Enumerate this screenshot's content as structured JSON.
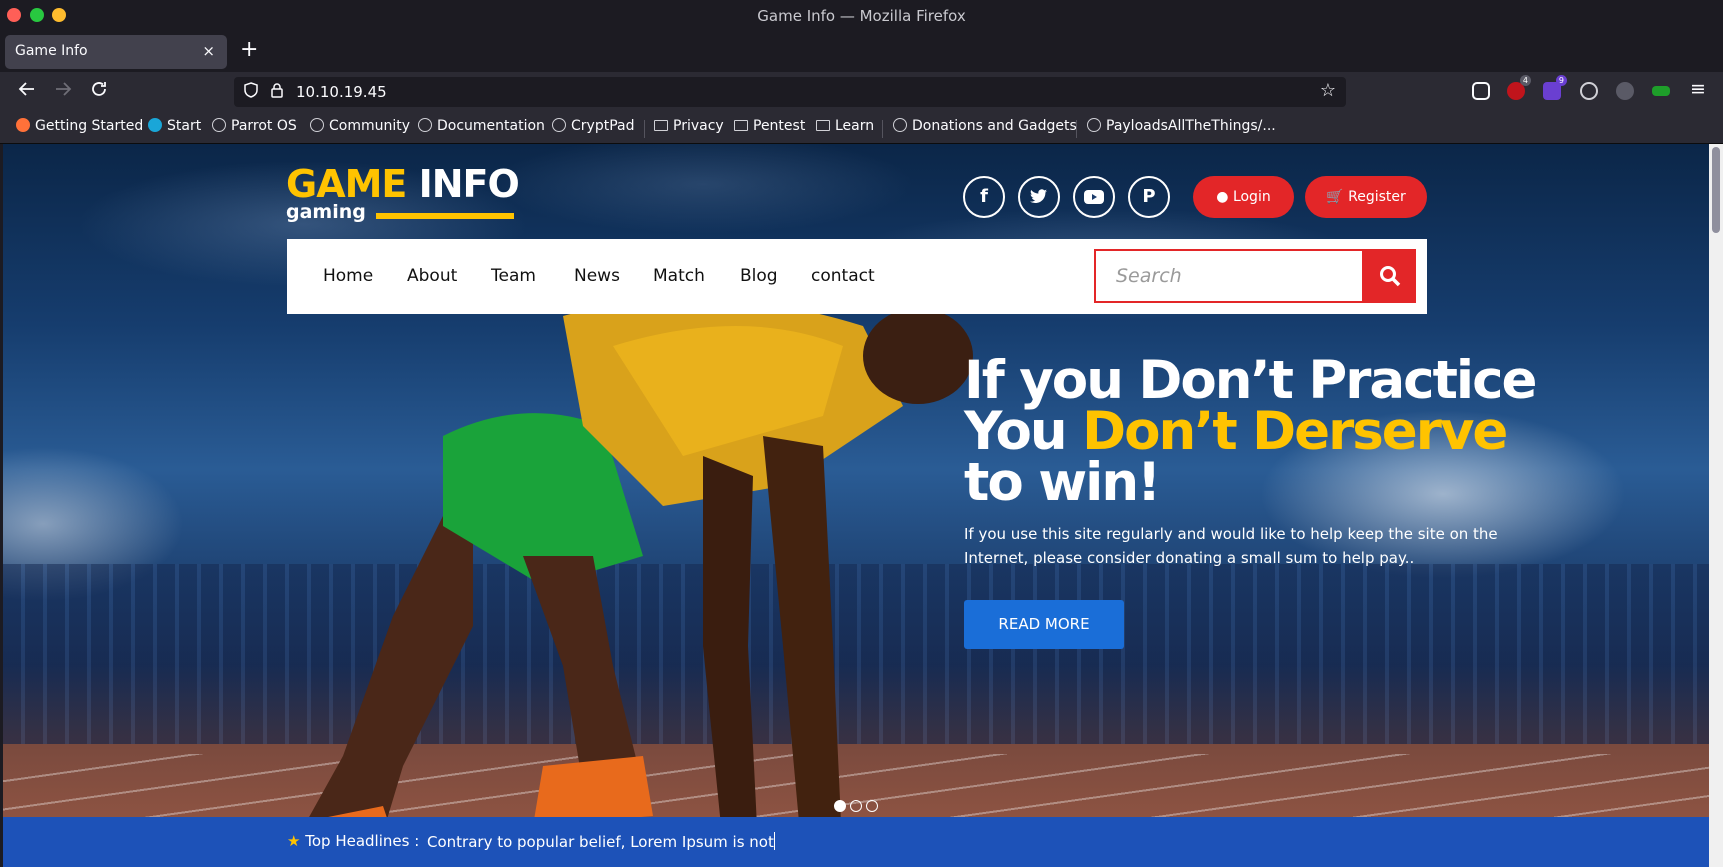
{
  "window": {
    "title": "Game Info — Mozilla Firefox"
  },
  "tab": {
    "title": "Game Info",
    "close": "×",
    "new_tab": "+"
  },
  "url": {
    "value": "10.10.19.45"
  },
  "bookmarks": [
    {
      "label": "Getting Started",
      "type": "firefox"
    },
    {
      "label": "Start",
      "type": "parrot"
    },
    {
      "label": "Parrot OS",
      "type": "globe"
    },
    {
      "label": "Community",
      "type": "globe"
    },
    {
      "label": "Documentation",
      "type": "globe"
    },
    {
      "label": "CryptPad",
      "type": "globe"
    },
    {
      "label": "Privacy",
      "type": "folder"
    },
    {
      "label": "Pentest",
      "type": "folder"
    },
    {
      "label": "Learn",
      "type": "folder"
    },
    {
      "label": "Donations and Gadgets",
      "type": "globe"
    },
    {
      "label": "PayloadsAllTheThings/...",
      "type": "globe"
    }
  ],
  "extensions": {
    "badge_1": "4",
    "badge_2": "9"
  },
  "site": {
    "logo": {
      "game": "GAME",
      "info": "INFO",
      "sub": "gaming"
    },
    "social": [
      "facebook",
      "twitter",
      "youtube",
      "pinterest"
    ],
    "login": "Login",
    "register": "Register",
    "menu": [
      "Home",
      "About",
      "Team",
      "News",
      "Match",
      "Blog",
      "contact"
    ],
    "search_placeholder": "Search",
    "hero": {
      "line1": "If you Don’t Practice",
      "line2_a": "You ",
      "line2_b": "Don’t Derserve",
      "line3": "to win!",
      "paragraph": "If you use this site regularly and would like to help keep the site on the Internet, please consider donating a small sum to help pay..",
      "cta": "READ MORE"
    },
    "slider": {
      "count": 3,
      "active": 0
    },
    "ticker": {
      "label": "Top Headlines :",
      "text": "Contrary to popular belief, Lorem Ipsum is not"
    }
  },
  "colors": {
    "brand_yellow": "#ffc300",
    "brand_red": "#e32628",
    "brand_blue": "#1a6ed8",
    "ticker_blue": "#1d52b8"
  }
}
